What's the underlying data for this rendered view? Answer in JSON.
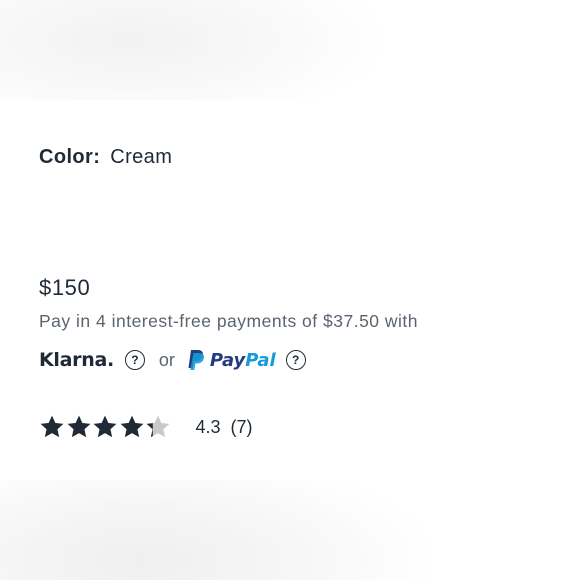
{
  "product": {
    "color_label": "Color:",
    "color_value": "Cream",
    "price": "$150"
  },
  "payment": {
    "installment_text": "Pay in 4 interest-free payments of $37.50 with",
    "klarna_label": "Klarna.",
    "or_text": "or",
    "paypal_pay": "Pay",
    "paypal_pal": "Pal",
    "help_symbol": "?"
  },
  "rating": {
    "value": "4.3",
    "count": "(7)",
    "stars_filled": 4.3,
    "stars_total": 5
  },
  "colors": {
    "text_dark": "#1f2a36",
    "text_muted": "#5a6470",
    "star_filled": "#1f2a36",
    "star_empty": "#c9c9c9",
    "paypal_dark": "#253b80",
    "paypal_light": "#179bd7"
  }
}
